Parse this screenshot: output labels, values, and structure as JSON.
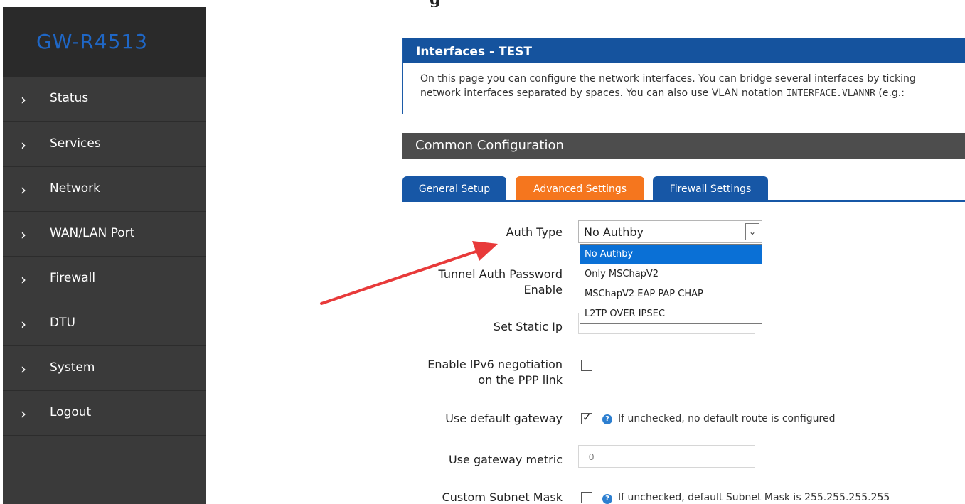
{
  "page": {
    "top_clip_char": "g"
  },
  "sidebar": {
    "brand": "GW-R4513",
    "items": [
      {
        "label": "Status"
      },
      {
        "label": "Services"
      },
      {
        "label": "Network"
      },
      {
        "label": "WAN/LAN Port"
      },
      {
        "label": "Firewall"
      },
      {
        "label": "DTU"
      },
      {
        "label": "System"
      },
      {
        "label": "Logout"
      }
    ],
    "chevron": "›"
  },
  "interfaces": {
    "title": "Interfaces - TEST",
    "desc_line1": "On this page you can configure the network interfaces. You can bridge several interfaces by ticking",
    "desc_line2_a": "network interfaces separated by spaces. You can also use ",
    "desc_line2_vlan": "VLAN",
    "desc_line2_b": " notation ",
    "desc_line2_code": "INTERFACE.VLANNR",
    "desc_line2_c": " (",
    "desc_line2_eg": "e.g.",
    "desc_line2_d": ":"
  },
  "section": {
    "title": "Common Configuration"
  },
  "tabs": {
    "general": "General Setup",
    "advanced": "Advanced Settings",
    "firewall": "Firewall Settings"
  },
  "form": {
    "auth_type_label": "Auth Type",
    "auth_type_value": "No Authby",
    "auth_options": [
      "No Authby",
      "Only MSChapV2",
      "MSChapV2 EAP PAP CHAP",
      "L2TP OVER IPSEC"
    ],
    "tunnel_label_1": "Tunnel Auth Password",
    "tunnel_label_2": "Enable",
    "static_ip_label": "Set Static Ip",
    "ipv6_label_1": "Enable IPv6 negotiation",
    "ipv6_label_2": "on the PPP link",
    "ipv6_checked": false,
    "default_gw_label": "Use default gateway",
    "default_gw_checked": true,
    "default_gw_help": "If unchecked, no default route is configured",
    "gw_metric_label": "Use gateway metric",
    "gw_metric_placeholder": "0",
    "subnet_label": "Custom Subnet Mask",
    "subnet_checked": false,
    "subnet_help": "If unchecked, default Subnet Mask is 255.255.255.255",
    "check_glyph": "✓",
    "help_glyph": "?",
    "select_arrow_glyph": "⌄"
  },
  "colors": {
    "sidebar_bg": "#3a3a3a",
    "brand_color": "#1f67c6",
    "header_blue": "#15539e",
    "tab_active": "#f5761e",
    "annotation_arrow": "#e83a3a"
  }
}
